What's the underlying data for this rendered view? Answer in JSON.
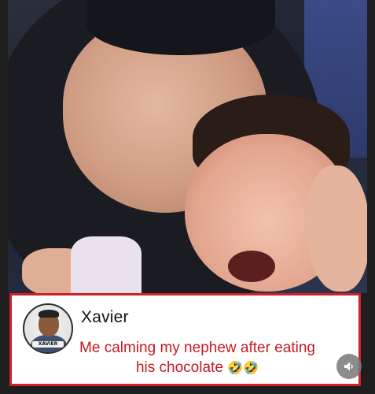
{
  "post": {
    "author": {
      "name": "Xavier",
      "avatar_tag": "XAVIER"
    },
    "caption": "Me calming my nephew after eating his chocolate",
    "caption_emojis": "🤣🤣",
    "accent_color": "#d0202a",
    "caption_color": "#c41a20"
  },
  "controls": {
    "sound_icon": "speaker-icon"
  }
}
